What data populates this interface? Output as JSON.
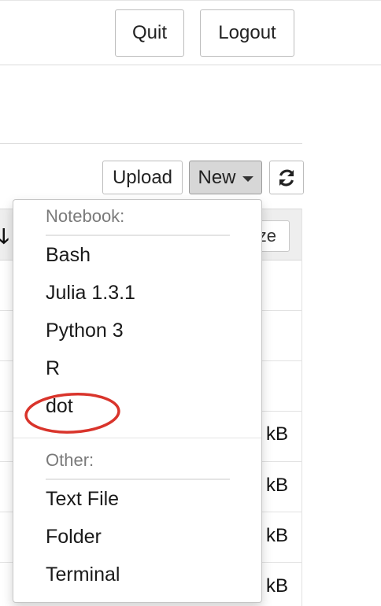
{
  "header": {
    "quit_label": "Quit",
    "logout_label": "Logout"
  },
  "toolbar": {
    "upload_label": "Upload",
    "new_label": "New",
    "refresh_icon": "refresh-icon"
  },
  "file_list": {
    "sort_icon": "arrow-down-icon",
    "size_column_label": "ze",
    "visible_sizes": [
      "kB",
      "kB",
      "kB",
      "kB"
    ]
  },
  "new_menu": {
    "notebook_header": "Notebook:",
    "notebook_items": [
      "Bash",
      "Julia 1.3.1",
      "Python 3",
      "R",
      "dot"
    ],
    "other_header": "Other:",
    "other_items": [
      "Text File",
      "Folder",
      "Terminal"
    ],
    "annotation_color": "#d9342b"
  }
}
